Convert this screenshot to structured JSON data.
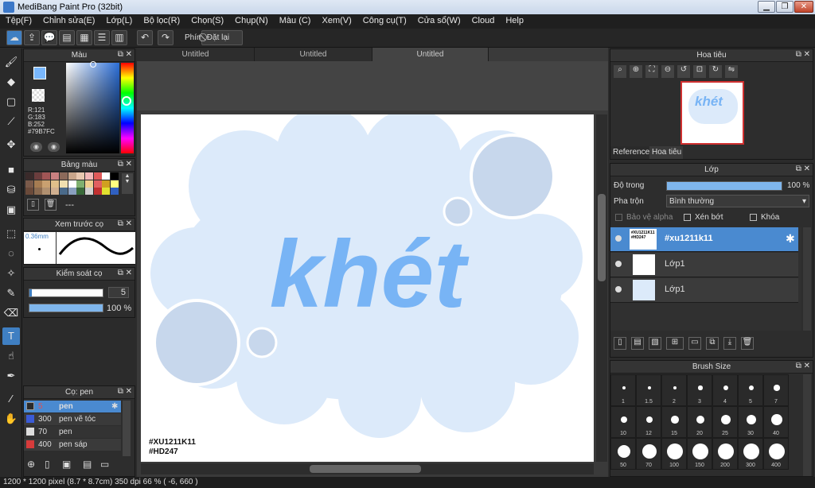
{
  "window": {
    "title": "MediBang Paint Pro (32bit)",
    "minimize": "▁",
    "maximize": "❐",
    "close": "✕"
  },
  "menu": [
    "Tệp(F)",
    "Chỉnh sửa(E)",
    "Lớp(L)",
    "Bộ lọc(R)",
    "Chọn(S)",
    "Chụp(N)",
    "Màu (C)",
    "Xem(V)",
    "Công cụ(T)",
    "Cửa sổ(W)",
    "Cloud",
    "Help"
  ],
  "toolbar": {
    "key_label": "Phím",
    "reset_label": "Đặt lại"
  },
  "color_panel": {
    "title": "Màu",
    "r": "R:121",
    "g": "G:183",
    "b": "B:252",
    "hex": "#79B7FC",
    "current_color": "#79b7fc"
  },
  "palette_panel": {
    "title": "Bảng màu",
    "dash": "---"
  },
  "preview_panel": {
    "title": "Xem trước cọ",
    "size": "0.36mm"
  },
  "brush_control": {
    "title": "Kiểm soát cọ",
    "size": "5",
    "opacity": "100 %"
  },
  "brush_panel": {
    "title": "Cọ: pen",
    "items": [
      {
        "size": "5",
        "name": "pen",
        "color": "#2a2a2a"
      },
      {
        "size": "300",
        "name": "pen vẽ tóc",
        "color": "#3b5bd6"
      },
      {
        "size": "70",
        "name": "pen",
        "color": "#dddddd"
      },
      {
        "size": "400",
        "name": "pen sáp",
        "color": "#d63b3b"
      }
    ]
  },
  "tabs": [
    "Untitled",
    "Untitled",
    "Untitled"
  ],
  "artwork": {
    "word": "khét",
    "signature_1": "#XU1211K11",
    "signature_2": "#HD247"
  },
  "navigator": {
    "title": "Hoa tiêu",
    "thumb_word": "khét",
    "tabs": [
      "Reference",
      "Hoa tiêu"
    ]
  },
  "layer_panel": {
    "title": "Lớp",
    "opacity_label": "Độ trong",
    "opacity_value": "100 %",
    "blend_label": "Pha trộn",
    "blend_value": "Bình thường",
    "protect_alpha": "Bảo vệ alpha",
    "clip": "Xén bớt",
    "lock": "Khóa",
    "layers": [
      {
        "name": "#xu1211k11",
        "thumb": "#XU1211K11 #HD247"
      },
      {
        "name": "Lớp1",
        "thumb": ""
      },
      {
        "name": "Lớp1",
        "thumb": ""
      }
    ]
  },
  "brush_size": {
    "title": "Brush Size",
    "sizes": [
      "1",
      "1.5",
      "2",
      "3",
      "4",
      "5",
      "7",
      "10",
      "12",
      "15",
      "20",
      "25",
      "30",
      "40",
      "50",
      "70",
      "100",
      "150",
      "200",
      "300",
      "400"
    ]
  },
  "status": {
    "text": "1200 * 1200 pixel  (8.7 * 8.7cm)  350 dpi  66 %  ( -6, 660 )"
  }
}
